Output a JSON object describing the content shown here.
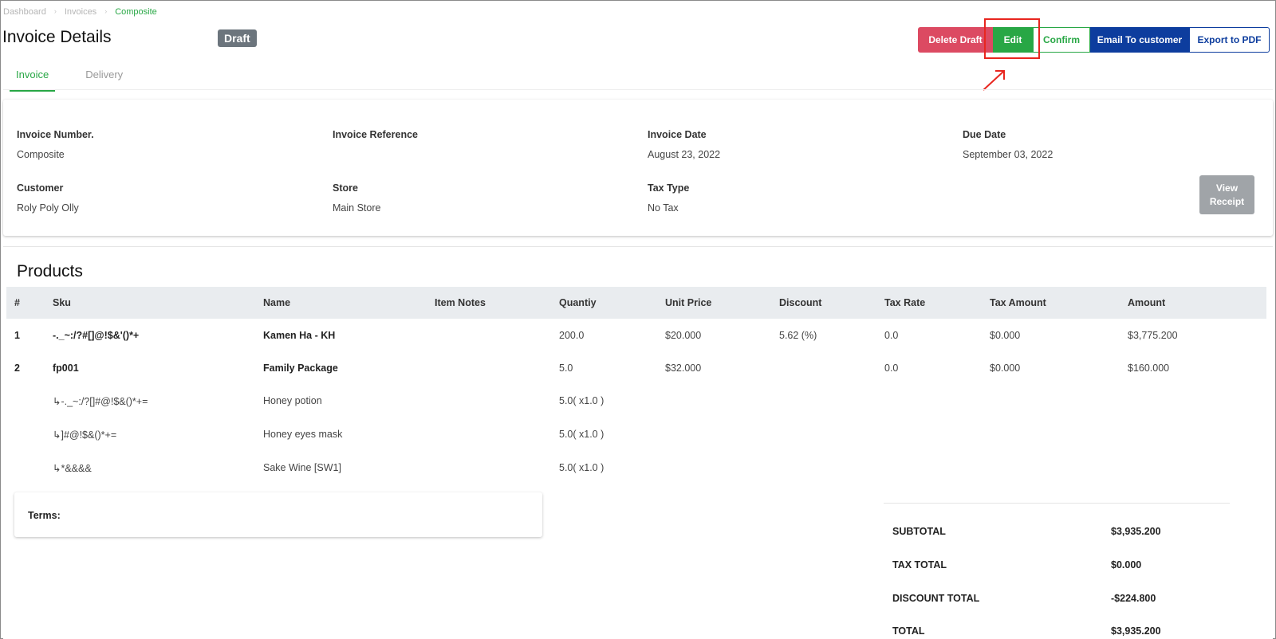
{
  "breadcrumb": [
    "Dashboard",
    "Invoices",
    "Composite"
  ],
  "page_title": "Invoice Details",
  "status_badge": "Draft",
  "actions": {
    "delete": "Delete Draft",
    "edit": "Edit",
    "confirm": "Confirm",
    "email": "Email To customer",
    "export": "Export to PDF"
  },
  "tabs": [
    {
      "label": "Invoice",
      "active": true
    },
    {
      "label": "Delivery",
      "active": false
    }
  ],
  "invoice": {
    "number_label": "Invoice Number.",
    "number": "Composite",
    "reference_label": "Invoice Reference",
    "reference": "",
    "date_label": "Invoice Date",
    "date": "August 23, 2022",
    "due_label": "Due Date",
    "due": "September 03, 2022",
    "customer_label": "Customer",
    "customer": "Roly Poly Olly",
    "store_label": "Store",
    "store": "Main Store",
    "tax_type_label": "Tax Type",
    "tax_type": "No Tax",
    "view_receipt": "View Receipt"
  },
  "products": {
    "title": "Products",
    "columns": [
      "#",
      "Sku",
      "Name",
      "Item Notes",
      "Quantiy",
      "Unit Price",
      "Discount",
      "Tax Rate",
      "Tax Amount",
      "Amount"
    ],
    "rows": [
      {
        "no": "1",
        "sku": "-._~:/?#[]@!$&'()*+",
        "name": "Kamen Ha - KH",
        "notes": "",
        "qty": "200.0",
        "unit_price": "$20.000",
        "discount": "5.62 (%)",
        "tax_rate": "0.0",
        "tax_amount": "$0.000",
        "amount": "$3,775.200"
      },
      {
        "no": "2",
        "sku": "fp001",
        "name": "Family Package",
        "notes": "",
        "qty": "5.0",
        "unit_price": "$32.000",
        "discount": "",
        "tax_rate": "0.0",
        "tax_amount": "$0.000",
        "amount": "$160.000"
      }
    ],
    "sub_rows": [
      {
        "sku": "↳-._~:/?[]#@!$&()*+=",
        "name": "Honey potion",
        "qty": "5.0( x1.0 )"
      },
      {
        "sku": "↳]#@!$&()*+=",
        "name": "Honey eyes mask",
        "qty": "5.0( x1.0 )"
      },
      {
        "sku": "↳*&&&&",
        "name": "Sake Wine [SW1]",
        "qty": "5.0( x1.0 )"
      }
    ]
  },
  "terms_label": "Terms:",
  "totals": {
    "subtotal_label": "SUBTOTAL",
    "subtotal": "$3,935.200",
    "tax_label": "TAX TOTAL",
    "tax": "$0.000",
    "discount_label": "DISCOUNT TOTAL",
    "discount": "-$224.800",
    "total_label": "TOTAL",
    "total": "$3,935.200"
  },
  "colors": {
    "accent_green": "#28a745",
    "danger": "#dc4a62",
    "primary_blue": "#0d3d9e",
    "badge_gray": "#6c757d",
    "annotation_red": "#e8261f"
  }
}
